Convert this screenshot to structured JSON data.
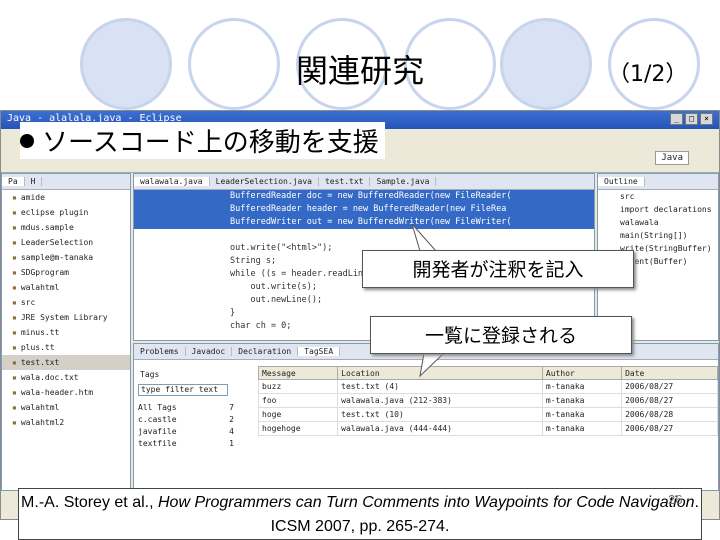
{
  "slide": {
    "title": "関連研究",
    "page_indicator": "（1/2）",
    "bullet": "ソースコード上の移動を支援",
    "page_number": "26"
  },
  "window": {
    "title": "Java - alalala.java - Eclipse",
    "perspective_label": "Java"
  },
  "package_explorer": {
    "tabs": [
      "Pa",
      "H"
    ],
    "items": [
      "amide",
      "eclipse plugin",
      "mdus.sample",
      "LeaderSelection",
      "sample@m-tanaka",
      "SDGprogram",
      "walahtml",
      "src",
      "JRE System Library",
      "minus.tt",
      "plus.tt",
      "test.txt",
      "wala.doc.txt",
      "wala-header.htm",
      "walahtml",
      "walahtml2"
    ]
  },
  "editor": {
    "tabs": [
      "walawala.java",
      "LeaderSelection.java",
      "test.txt",
      "Sample.java"
    ],
    "lines": [
      "BufferedReader doc = new BufferedReader(new FileReader(",
      "BufferedReader header = new BufferedReader(new FileRea",
      "BufferedWriter out = new BufferedWriter(new FileWriter(",
      "",
      "out.write(\"<html>\");",
      "String s;",
      "while ((s = header.readLine()) != null) {",
      "    out.write(s);",
      "    out.newLine();",
      "}",
      "char ch = 0;"
    ]
  },
  "outline": {
    "tab": "Outline",
    "items": [
      "src",
      "import declarations",
      "walawala",
      "main(String[])",
      "write(StringBuffer)",
      "indent(Buffer)"
    ]
  },
  "bottom_panel": {
    "tabs": [
      "Problems",
      "Javadoc",
      "Declaration",
      "TagSEA"
    ],
    "tags_label": "Tags",
    "filter_placeholder": "type filter text",
    "tag_tree": [
      {
        "name": "All Tags",
        "count": "7"
      },
      {
        "name": "c.castle",
        "count": "2"
      },
      {
        "name": "javafile",
        "count": "4"
      },
      {
        "name": "textfile",
        "count": "1"
      }
    ],
    "columns": [
      "Message",
      "Location",
      "Author",
      "Date"
    ],
    "rows": [
      [
        "buzz",
        "test.txt (4)",
        "m-tanaka",
        "2006/08/27"
      ],
      [
        "foo",
        "walawala.java (212-383)",
        "m-tanaka",
        "2006/08/27"
      ],
      [
        "hoge",
        "test.txt (10)",
        "m-tanaka",
        "2006/08/28"
      ],
      [
        "hogehoge",
        "walawala.java (444-444)",
        "m-tanaka",
        "2006/08/27"
      ]
    ]
  },
  "callouts": {
    "annotate": "開発者が注釈を記入",
    "listed": "一覧に登録される"
  },
  "citation": {
    "authors": "M.-A. Storey et al.,",
    "title_italic": "How Programmers can Turn Comments into Waypoints for Code Navigation",
    "venue": ". ICSM 2007, pp. 265-274."
  }
}
